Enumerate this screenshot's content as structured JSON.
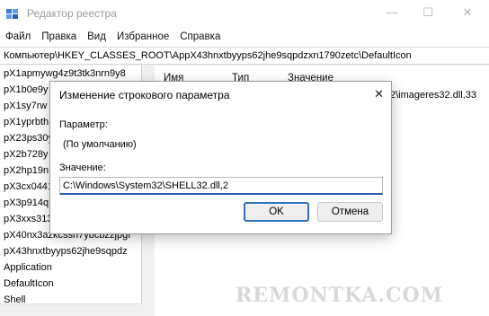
{
  "window": {
    "title": "Редактор реестра",
    "minimize": "—",
    "maximize": "☐",
    "close": "✕"
  },
  "menu": [
    "Файл",
    "Правка",
    "Вид",
    "Избранное",
    "Справка"
  ],
  "address": "Компьютер\\HKEY_CLASSES_ROOT\\AppX43hnxtbyyps62jhe9sqpdzxn1790zetc\\DefaultIcon",
  "tree": {
    "items": [
      "pX1apmywg4z9t3tk3nrn9y8",
      "pX1b0e9y",
      "pX1sy7rw",
      "pX1yprbth",
      "pX23ps30y",
      "pX2b728y",
      "pX2hp19n",
      "pX3cx0441",
      "pX3p914q",
      "pX3xxs313",
      "pX40nx3azkcssh7ybcbzzjpgf",
      "pX43hnxtbyyps62jhe9sqpdz",
      "Application",
      "DefaultIcon",
      "Shell"
    ]
  },
  "list": {
    "columns": [
      "Имя",
      "Тип",
      "Значение"
    ],
    "value_fragment": "2\\imageres32.dll,33"
  },
  "dialog": {
    "title": "Изменение строкового параметра",
    "close": "✕",
    "param_label": "Параметр:",
    "param_value": "(По умолчанию)",
    "value_label": "Значение:",
    "value_value": "C:\\Windows\\System32\\SHELL32.dll,2",
    "ok_label": "OK",
    "cancel_label": "Отмена"
  },
  "watermark": "REMONTKA.COM",
  "colors": {
    "accent": "#2f6fbe",
    "input_underline": "#2a5bb5",
    "watermark": "#d8d8d8"
  }
}
